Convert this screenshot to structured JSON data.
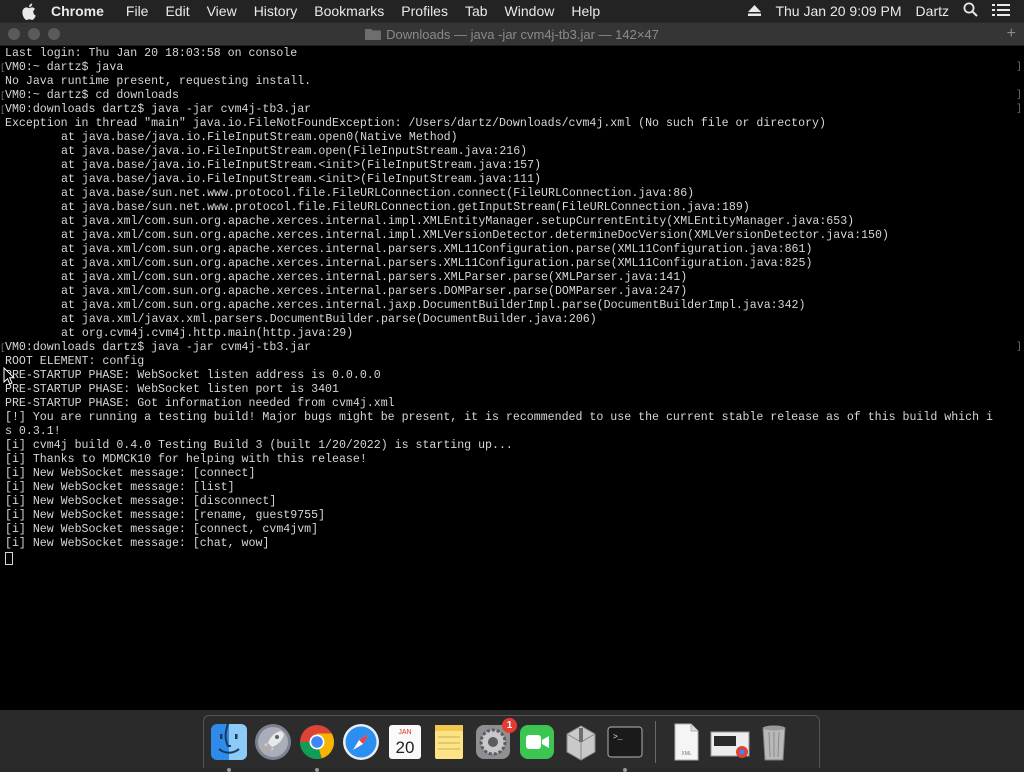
{
  "menubar": {
    "app_name": "Chrome",
    "items": [
      "File",
      "Edit",
      "View",
      "History",
      "Bookmarks",
      "Profiles",
      "Tab",
      "Window",
      "Help"
    ],
    "datetime": "Thu Jan 20  9:09 PM",
    "user": "Dartz"
  },
  "window": {
    "title": "Downloads — java -jar cvm4j-tb3.jar — 142×47",
    "new_tab": "+"
  },
  "terminal": {
    "lines": [
      {
        "text": "Last login: Thu Jan 20 18:03:58 on console"
      },
      {
        "text": "VM0:~ dartz$ java",
        "prompt": true
      },
      {
        "text": "No Java runtime present, requesting install."
      },
      {
        "text": "VM0:~ dartz$ cd downloads",
        "prompt": true
      },
      {
        "text": "VM0:downloads dartz$ java -jar cvm4j-tb3.jar",
        "prompt": true
      },
      {
        "text": "Exception in thread \"main\" java.io.FileNotFoundException: /Users/dartz/Downloads/cvm4j.xml (No such file or directory)"
      },
      {
        "text": "at java.base/java.io.FileInputStream.open0(Native Method)",
        "indent": true
      },
      {
        "text": "at java.base/java.io.FileInputStream.open(FileInputStream.java:216)",
        "indent": true
      },
      {
        "text": "at java.base/java.io.FileInputStream.<init>(FileInputStream.java:157)",
        "indent": true
      },
      {
        "text": "at java.base/java.io.FileInputStream.<init>(FileInputStream.java:111)",
        "indent": true
      },
      {
        "text": "at java.base/sun.net.www.protocol.file.FileURLConnection.connect(FileURLConnection.java:86)",
        "indent": true
      },
      {
        "text": "at java.base/sun.net.www.protocol.file.FileURLConnection.getInputStream(FileURLConnection.java:189)",
        "indent": true
      },
      {
        "text": "at java.xml/com.sun.org.apache.xerces.internal.impl.XMLEntityManager.setupCurrentEntity(XMLEntityManager.java:653)",
        "indent": true
      },
      {
        "text": "at java.xml/com.sun.org.apache.xerces.internal.impl.XMLVersionDetector.determineDocVersion(XMLVersionDetector.java:150)",
        "indent": true
      },
      {
        "text": "at java.xml/com.sun.org.apache.xerces.internal.parsers.XML11Configuration.parse(XML11Configuration.java:861)",
        "indent": true
      },
      {
        "text": "at java.xml/com.sun.org.apache.xerces.internal.parsers.XML11Configuration.parse(XML11Configuration.java:825)",
        "indent": true
      },
      {
        "text": "at java.xml/com.sun.org.apache.xerces.internal.parsers.XMLParser.parse(XMLParser.java:141)",
        "indent": true
      },
      {
        "text": "at java.xml/com.sun.org.apache.xerces.internal.parsers.DOMParser.parse(DOMParser.java:247)",
        "indent": true
      },
      {
        "text": "at java.xml/com.sun.org.apache.xerces.internal.jaxp.DocumentBuilderImpl.parse(DocumentBuilderImpl.java:342)",
        "indent": true
      },
      {
        "text": "at java.xml/javax.xml.parsers.DocumentBuilder.parse(DocumentBuilder.java:206)",
        "indent": true
      },
      {
        "text": "at org.cvm4j.cvm4j.http.main(http.java:29)",
        "indent": true
      },
      {
        "text": "VM0:downloads dartz$ java -jar cvm4j-tb3.jar",
        "prompt": true
      },
      {
        "text": "ROOT ELEMENT: config"
      },
      {
        "text": "PRE-STARTUP PHASE: WebSocket listen address is 0.0.0.0"
      },
      {
        "text": "PRE-STARTUP PHASE: WebSocket listen port is 3401"
      },
      {
        "text": "PRE-STARTUP PHASE: Got information needed from cvm4j.xml"
      },
      {
        "text": "[!] You are running a testing build! Major bugs might be present, it is recommended to use the current stable release as of this build which i"
      },
      {
        "text": "s 0.3.1!"
      },
      {
        "text": "[i] cvm4j build 0.4.0 Testing Build 3 (built 1/20/2022) is starting up..."
      },
      {
        "text": "[i] Thanks to MDMCK10 for helping with this release!"
      },
      {
        "text": "[i] New WebSocket message: [connect]"
      },
      {
        "text": "[i] New WebSocket message: [list]"
      },
      {
        "text": "[i] New WebSocket message: [disconnect]"
      },
      {
        "text": "[i] New WebSocket message: [rename, guest9755]"
      },
      {
        "text": "[i] New WebSocket message: [connect, cvm4jvm]"
      },
      {
        "text": "[i] New WebSocket message: [chat, wow]"
      }
    ]
  },
  "dock": {
    "calendar_month": "JAN",
    "calendar_day": "20",
    "prefs_badge": "1",
    "terminal_glyph": ">_",
    "file_label": "XML"
  }
}
